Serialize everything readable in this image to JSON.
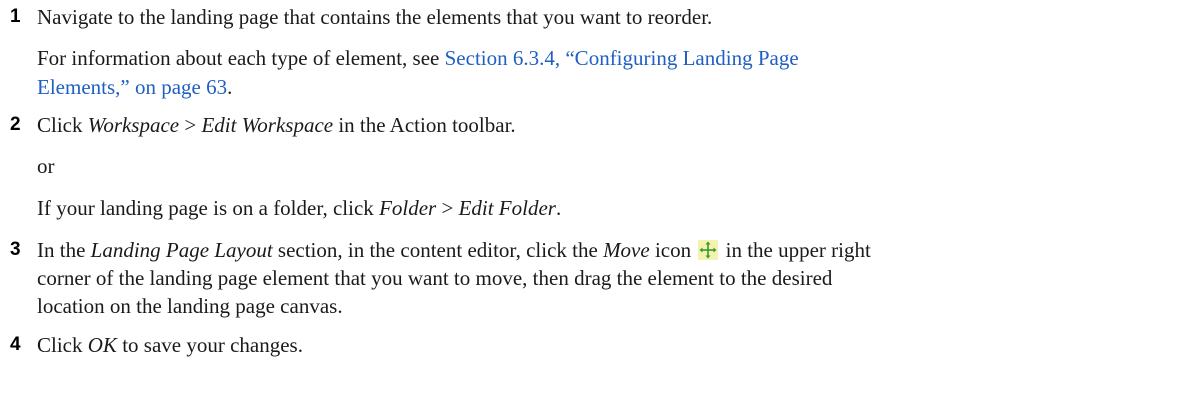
{
  "steps": [
    {
      "number": "1",
      "text": "Navigate to the landing page that contains the elements that you want to reorder.",
      "info_prefix": "For information about each type of element, see ",
      "info_link_line1": "Section 6.3.4, “Configuring Landing Page",
      "info_link_line2": "Elements,” on page 63",
      "info_suffix": "."
    },
    {
      "number": "2",
      "pre": "Click ",
      "menu1": "Workspace",
      "sep": " > ",
      "item1": "Edit Workspace",
      "post": " in the Action toolbar.",
      "or": "or",
      "alt_pre": "If your landing page is on a folder, click ",
      "menu2": "Folder",
      "item2": "Edit Folder",
      "alt_post": "."
    },
    {
      "number": "3",
      "pre": "In the ",
      "section": "Landing Page Layout",
      "mid": " section, in the content editor, click the ",
      "move": "Move",
      "icon_word": " icon",
      "after_icon": " in the upper right",
      "line2": "corner of the landing page element that you want to move, then drag the element to the desired",
      "line3": "location on the landing page canvas."
    },
    {
      "number": "4",
      "pre": "Click ",
      "ok": "OK",
      "post": " to save your changes."
    }
  ],
  "icons": {
    "move": "move-arrows-icon",
    "move_bg": "#f3f2b0",
    "move_fg": "#3a9a2a"
  },
  "colors": {
    "link": "#1f5fc4",
    "text": "#1a1a1a"
  }
}
